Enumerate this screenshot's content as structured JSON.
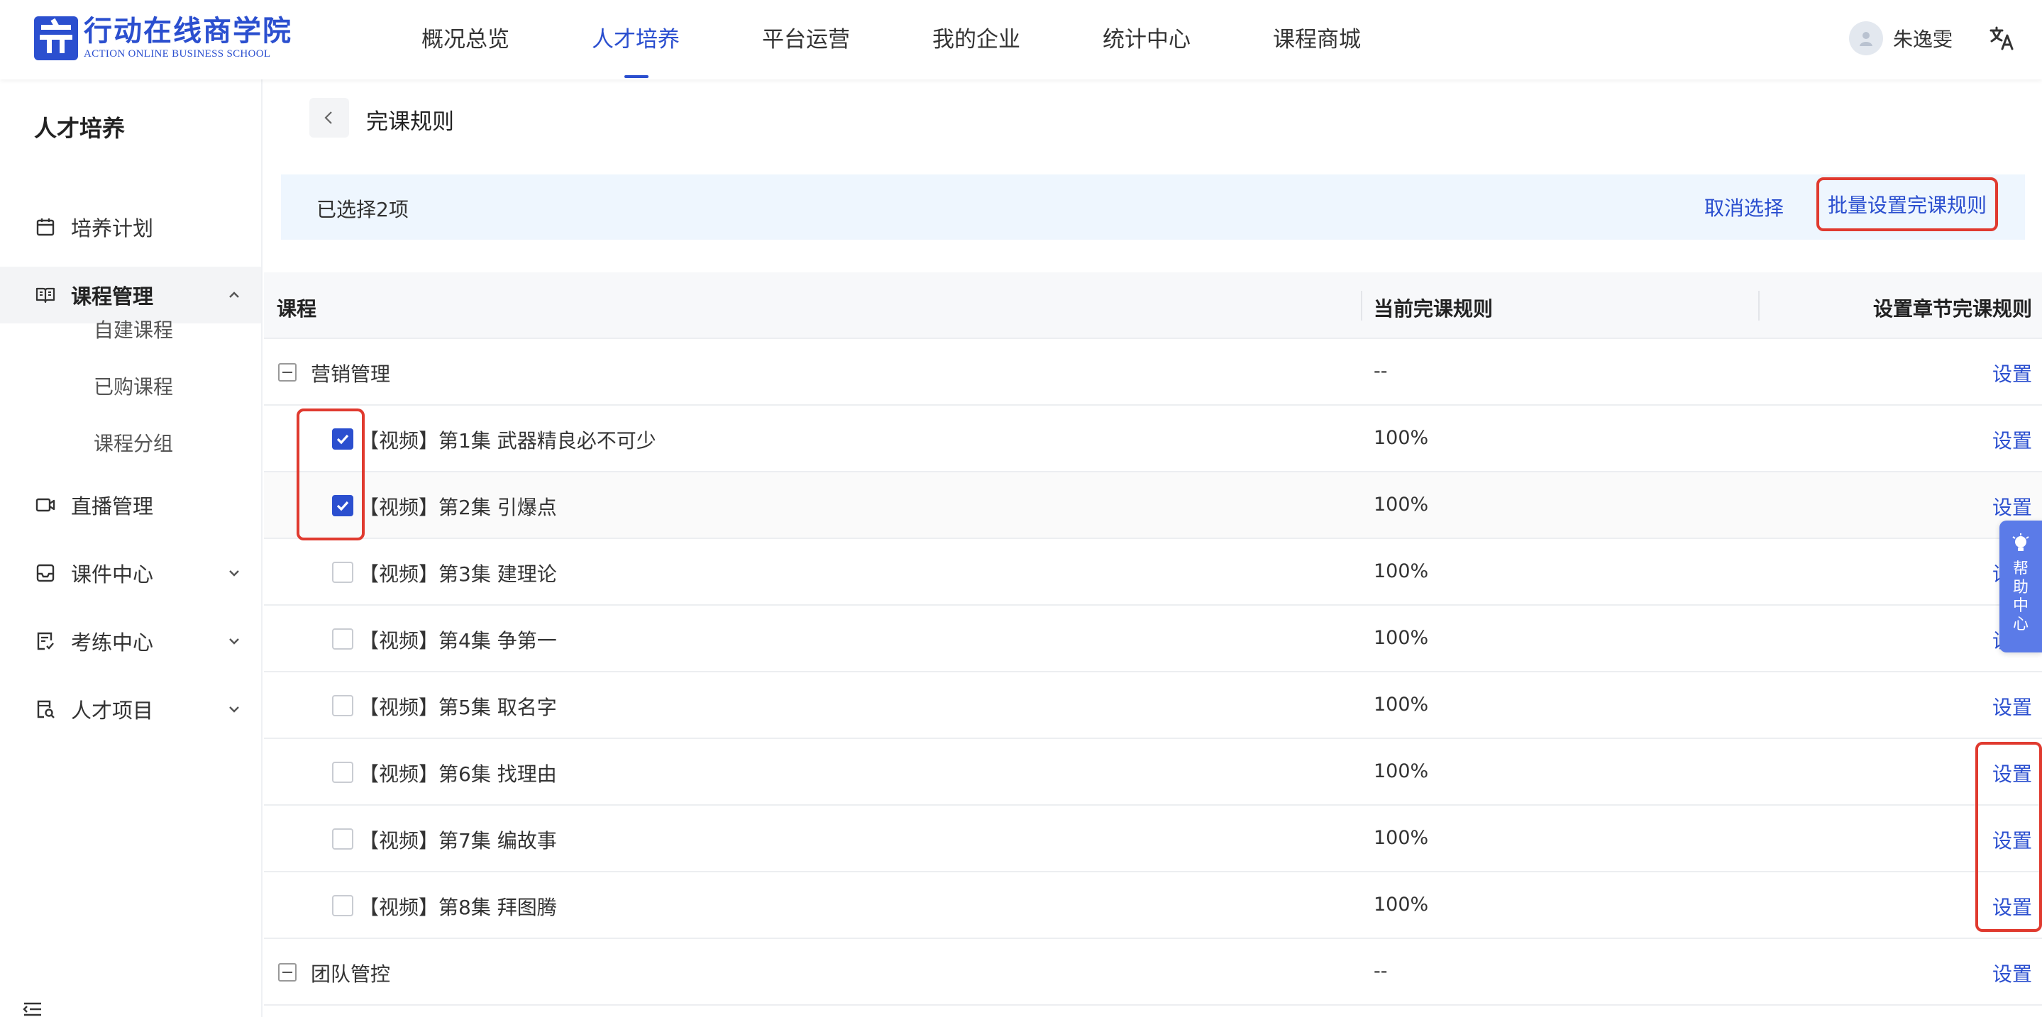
{
  "brand": {
    "name_cn": "行动在线商学院",
    "name_en": "ACTION ONLINE BUSINESS SCHOOL",
    "color": "#2b4fcf"
  },
  "topnav": {
    "items": [
      {
        "label": "概况总览"
      },
      {
        "label": "人才培养",
        "active": true
      },
      {
        "label": "平台运营"
      },
      {
        "label": "我的企业"
      },
      {
        "label": "统计中心"
      },
      {
        "label": "课程商城"
      }
    ]
  },
  "user": {
    "name": "朱逸雯",
    "avatar_icon": "user-avatar-icon",
    "language_icon": "translate-icon"
  },
  "sidebar": {
    "title": "人才培养",
    "items": [
      {
        "label": "培养计划",
        "icon": "calendar-icon"
      },
      {
        "label": "课程管理",
        "icon": "book-icon",
        "expanded": true,
        "children": [
          {
            "label": "自建课程"
          },
          {
            "label": "已购课程"
          },
          {
            "label": "课程分组"
          }
        ]
      },
      {
        "label": "直播管理",
        "icon": "video-icon"
      },
      {
        "label": "课件中心",
        "icon": "inbox-icon"
      },
      {
        "label": "考练中心",
        "icon": "exam-icon"
      },
      {
        "label": "人才项目",
        "icon": "project-icon"
      }
    ]
  },
  "page": {
    "title": "完课规则",
    "back_icon": "chevron-left-icon"
  },
  "selection_bar": {
    "selected_text": "已选择2项",
    "cancel_label": "取消选择",
    "batch_label": "批量设置完课规则"
  },
  "table": {
    "headers": {
      "course": "课程",
      "current_rule": "当前完课规则",
      "set_chapter_rule": "设置章节完课规则"
    },
    "rows": [
      {
        "type": "group",
        "name": "营销管理",
        "rule": "--",
        "action": "设置"
      },
      {
        "type": "item",
        "name": "【视频】第1集 武器精良必不可少",
        "rule": "100%",
        "action": "设置",
        "checked": true
      },
      {
        "type": "item",
        "name": "【视频】第2集 引爆点",
        "rule": "100%",
        "action": "设置",
        "checked": true
      },
      {
        "type": "item",
        "name": "【视频】第3集 建理论",
        "rule": "100%",
        "action": "设置",
        "checked": false
      },
      {
        "type": "item",
        "name": "【视频】第4集 争第一",
        "rule": "100%",
        "action": "设置",
        "checked": false
      },
      {
        "type": "item",
        "name": "【视频】第5集 取名字",
        "rule": "100%",
        "action": "设置",
        "checked": false
      },
      {
        "type": "item",
        "name": "【视频】第6集 找理由",
        "rule": "100%",
        "action": "设置",
        "checked": false
      },
      {
        "type": "item",
        "name": "【视频】第7集 编故事",
        "rule": "100%",
        "action": "设置",
        "checked": false
      },
      {
        "type": "item",
        "name": "【视频】第8集 拜图腾",
        "rule": "100%",
        "action": "设置",
        "checked": false
      },
      {
        "type": "group",
        "name": "团队管控",
        "rule": "--",
        "action": "设置"
      }
    ]
  },
  "help": {
    "label": "帮助中心",
    "icon": "lightbulb-icon"
  },
  "colors": {
    "accent": "#2b4fcf",
    "highlight": "#e03a2f",
    "selection_bg": "#eef6fe"
  }
}
